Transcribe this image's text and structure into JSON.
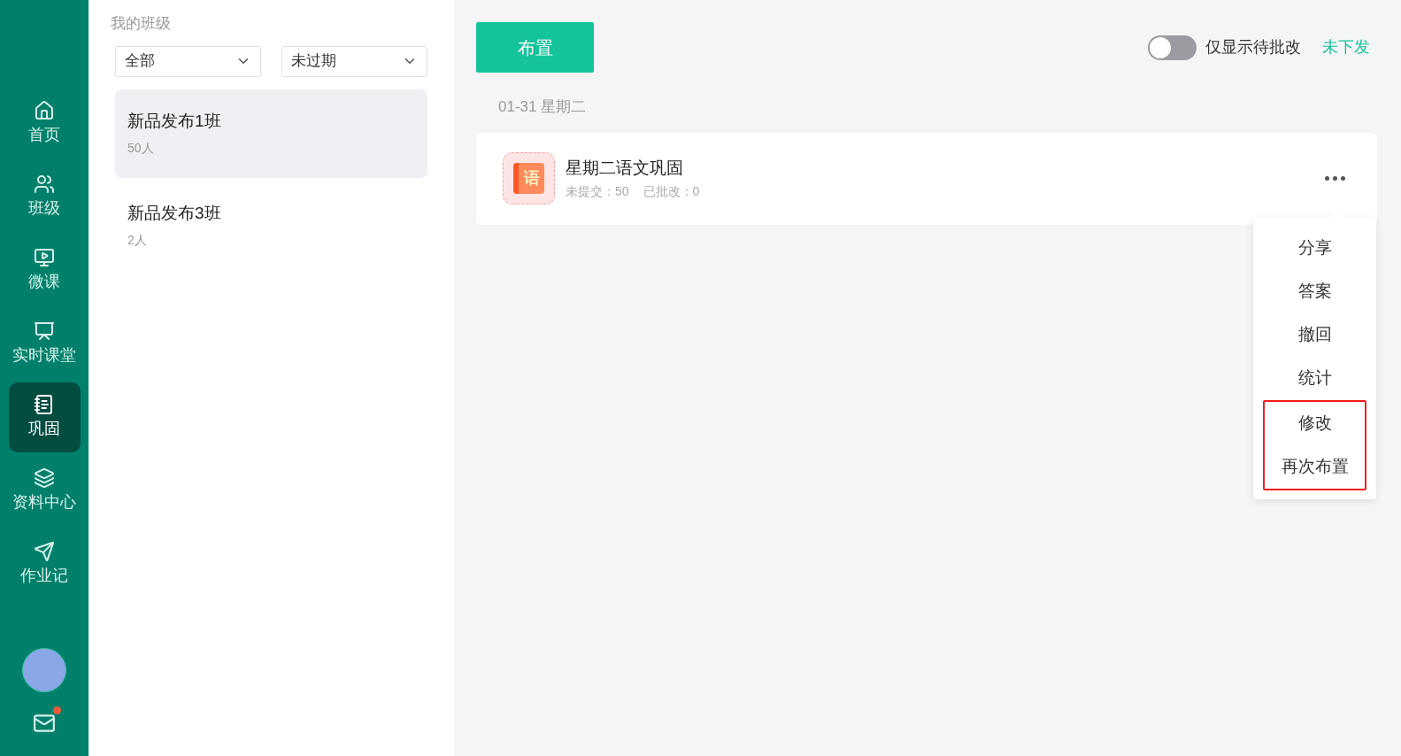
{
  "nav": [
    {
      "label": "首页",
      "kind": "home",
      "selected": false
    },
    {
      "label": "班级",
      "kind": "class",
      "selected": false
    },
    {
      "label": "微课",
      "kind": "video",
      "selected": false
    },
    {
      "label": "实时课堂",
      "kind": "live",
      "selected": false
    },
    {
      "label": "巩固",
      "kind": "book",
      "selected": true
    },
    {
      "label": "资料中心",
      "kind": "layers",
      "selected": false
    },
    {
      "label": "作业记",
      "kind": "send",
      "selected": false
    }
  ],
  "mail": {
    "unread": true
  },
  "classes_panel": {
    "title": "我的班级",
    "filters": [
      "全部",
      "未过期"
    ],
    "classes": [
      {
        "name": "新品发布1班",
        "count": "50人",
        "selected": true
      },
      {
        "name": "新品发布3班",
        "count": "2人",
        "selected": false
      }
    ]
  },
  "toolbar": {
    "assign_button": "布置",
    "toggle": {
      "label": "仅显示待批改",
      "on": false
    },
    "link": "未下发"
  },
  "date": "01-31 星期二",
  "assignment": {
    "subject": "语",
    "title": "星期二语文巩固",
    "stats": [
      "未提交：50",
      "已批改：0"
    ]
  },
  "menu": [
    {
      "label": "分享",
      "highlighted": false
    },
    {
      "label": "答案",
      "highlighted": false
    },
    {
      "label": "撤回",
      "highlighted": false
    },
    {
      "label": "统计",
      "highlighted": false
    },
    {
      "label": "修改",
      "highlighted": true
    },
    {
      "label": "再次布置",
      "highlighted": true
    }
  ]
}
